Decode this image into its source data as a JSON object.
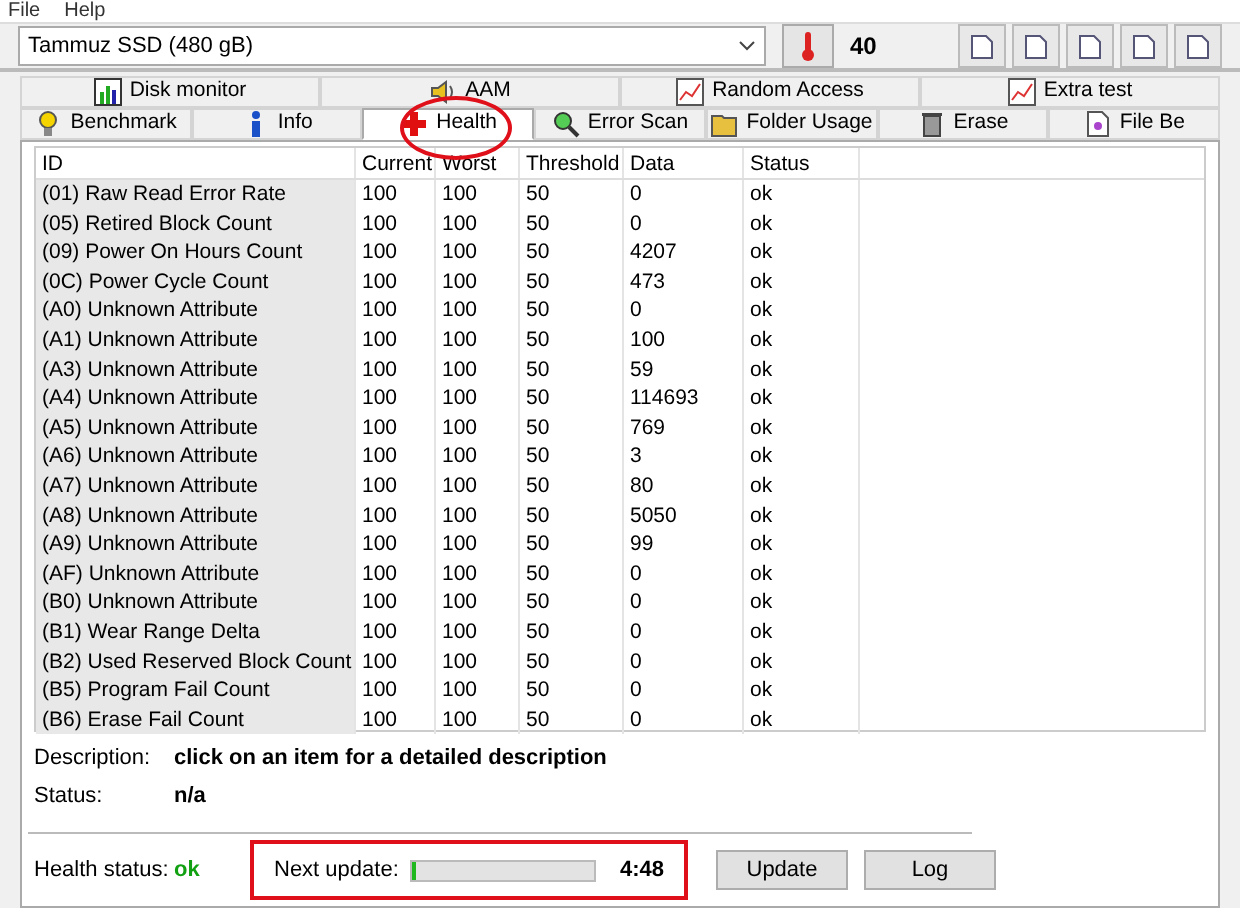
{
  "menu": [
    "File",
    "Help"
  ],
  "drive": {
    "value": "Tammuz SSD (480 gB)"
  },
  "temperature": "40",
  "tab_rows": [
    [
      {
        "label": "Disk monitor",
        "kind": "monitor",
        "selected": false
      },
      {
        "label": "AAM",
        "kind": "speaker",
        "selected": false
      },
      {
        "label": "Random Access",
        "kind": "chart",
        "selected": false
      },
      {
        "label": "Extra test",
        "kind": "chart",
        "selected": false
      }
    ],
    [
      {
        "label": "Benchmark",
        "kind": "bulb",
        "selected": false
      },
      {
        "label": "Info",
        "kind": "info",
        "selected": false
      },
      {
        "label": "Health",
        "kind": "cross",
        "selected": true
      },
      {
        "label": "Error Scan",
        "kind": "magnifier",
        "selected": false
      },
      {
        "label": "Folder Usage",
        "kind": "folder",
        "selected": false
      },
      {
        "label": "Erase",
        "kind": "bin",
        "selected": false
      },
      {
        "label": "File Be",
        "kind": "file",
        "selected": false
      }
    ]
  ],
  "table": {
    "columns": [
      "ID",
      "Current",
      "Worst",
      "Threshold",
      "Data",
      "Status"
    ],
    "rows": [
      [
        "(01) Raw Read Error Rate",
        "100",
        "100",
        "50",
        "0",
        "ok"
      ],
      [
        "(05) Retired Block Count",
        "100",
        "100",
        "50",
        "0",
        "ok"
      ],
      [
        "(09) Power On Hours Count",
        "100",
        "100",
        "50",
        "4207",
        "ok"
      ],
      [
        "(0C) Power Cycle Count",
        "100",
        "100",
        "50",
        "473",
        "ok"
      ],
      [
        "(A0) Unknown Attribute",
        "100",
        "100",
        "50",
        "0",
        "ok"
      ],
      [
        "(A1) Unknown Attribute",
        "100",
        "100",
        "50",
        "100",
        "ok"
      ],
      [
        "(A3) Unknown Attribute",
        "100",
        "100",
        "50",
        "59",
        "ok"
      ],
      [
        "(A4) Unknown Attribute",
        "100",
        "100",
        "50",
        "114693",
        "ok"
      ],
      [
        "(A5) Unknown Attribute",
        "100",
        "100",
        "50",
        "769",
        "ok"
      ],
      [
        "(A6) Unknown Attribute",
        "100",
        "100",
        "50",
        "3",
        "ok"
      ],
      [
        "(A7) Unknown Attribute",
        "100",
        "100",
        "50",
        "80",
        "ok"
      ],
      [
        "(A8) Unknown Attribute",
        "100",
        "100",
        "50",
        "5050",
        "ok"
      ],
      [
        "(A9) Unknown Attribute",
        "100",
        "100",
        "50",
        "99",
        "ok"
      ],
      [
        "(AF) Unknown Attribute",
        "100",
        "100",
        "50",
        "0",
        "ok"
      ],
      [
        "(B0) Unknown Attribute",
        "100",
        "100",
        "50",
        "0",
        "ok"
      ],
      [
        "(B1) Wear Range Delta",
        "100",
        "100",
        "50",
        "0",
        "ok"
      ],
      [
        "(B2) Used Reserved Block Count",
        "100",
        "100",
        "50",
        "0",
        "ok"
      ],
      [
        "(B5) Program Fail Count",
        "100",
        "100",
        "50",
        "0",
        "ok"
      ],
      [
        "(B6) Erase Fail Count",
        "100",
        "100",
        "50",
        "0",
        "ok"
      ]
    ]
  },
  "description": {
    "label": "Description:",
    "value": "click on an item for a detailed description"
  },
  "status": {
    "label": "Status:",
    "value": "n/a"
  },
  "health_status": {
    "label": "Health status:",
    "value": "ok"
  },
  "next_update": {
    "label": "Next update:",
    "level": 0.02,
    "time": "4:48"
  },
  "buttons": [
    "Update",
    "Log"
  ]
}
